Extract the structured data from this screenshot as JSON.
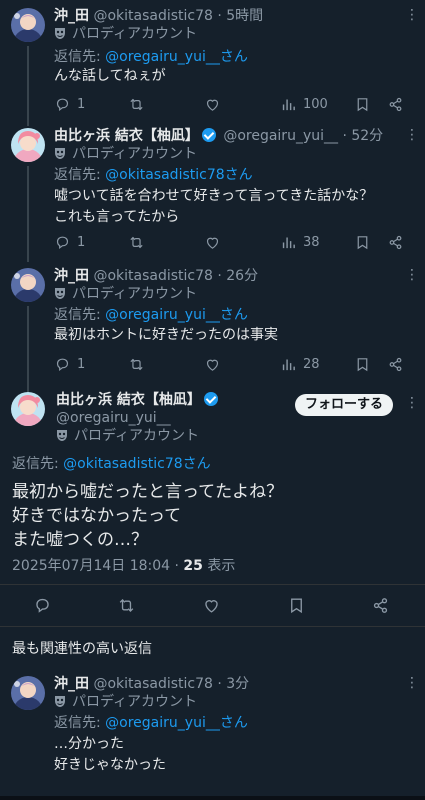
{
  "parody_label": "パロディアカウント",
  "reply_prefix": "返信先:",
  "tweets": [
    {
      "name": "沖_田",
      "handle": "@okitasadistic78",
      "time": "· 5時間",
      "reply_to": "@oregairu_yui__さん",
      "lines": [
        "んな話してねぇが"
      ],
      "replies": "1",
      "views": "100"
    },
    {
      "name": "由比ヶ浜 結衣【柚凪】",
      "handle": "@oregairu_yui__",
      "time": "· 52分",
      "reply_to": "@okitasadistic78さん",
      "lines": [
        "嘘ついて話を合わせて好きって言ってきた話かな？",
        "これも言ってたから"
      ],
      "replies": "1",
      "views": "38"
    },
    {
      "name": "沖_田",
      "handle": "@okitasadistic78",
      "time": "· 26分",
      "reply_to": "@oregairu_yui__さん",
      "lines": [
        "最初はホントに好きだったのは事実"
      ],
      "replies": "1",
      "views": "28"
    }
  ],
  "main_tweet": {
    "name": "由比ヶ浜 結衣【柚凪】",
    "handle": "@oregairu_yui__",
    "follow_label": "フォローする",
    "reply_to": "@okitasadistic78さん",
    "lines": [
      "最初から嘘だったと言ってたよね？",
      "好きではなかったって",
      "また嘘つくの…？"
    ],
    "date": "2025年07月14日 18:04 · ",
    "views_count": "25",
    "views_label": " 表示"
  },
  "section_title": "最も関連性の高い返信",
  "reply_tweet": {
    "name": "沖_田",
    "handle": "@okitasadistic78",
    "time": "· 3分",
    "reply_to": "@oregairu_yui__さん",
    "lines": [
      "…分かった",
      "好きじゃなかった"
    ]
  },
  "colors": {
    "background": "#15202b",
    "accent": "#1d9bf0",
    "muted": "#8b98a5"
  }
}
